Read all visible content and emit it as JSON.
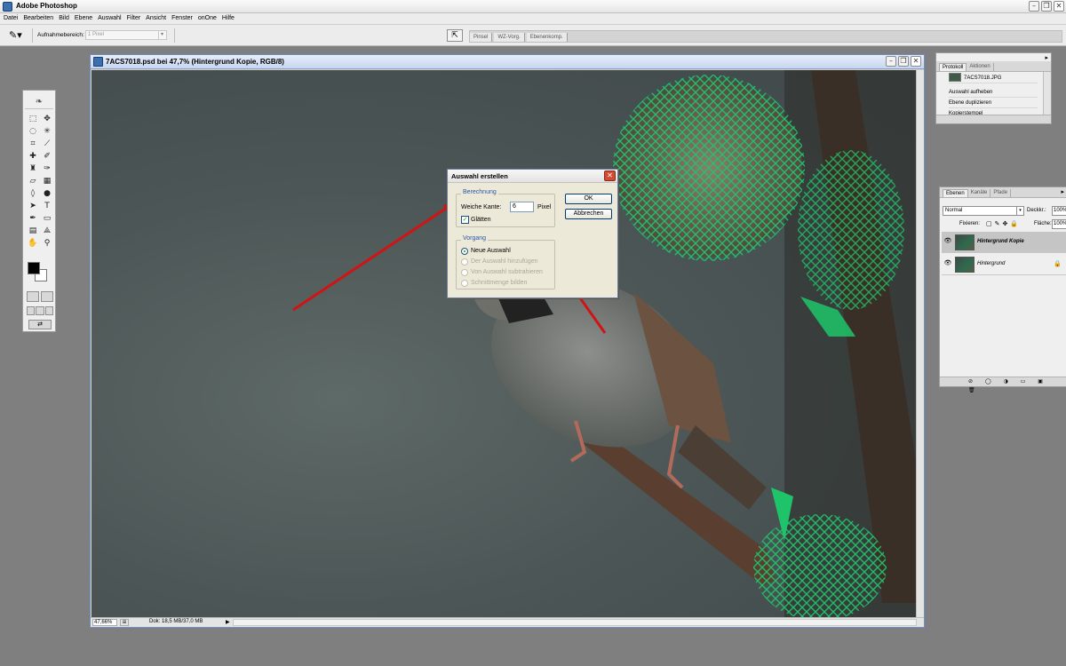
{
  "app": {
    "title": "Adobe Photoshop"
  },
  "menu": [
    "Datei",
    "Bearbeiten",
    "Bild",
    "Ebene",
    "Auswahl",
    "Filter",
    "Ansicht",
    "Fenster",
    "onOne",
    "Hilfe"
  ],
  "options": {
    "sample_label": "Aufnahmebereich:",
    "sample_value": "1 Pixel",
    "well_tabs": [
      "Pinsel",
      "WZ-Vorg.",
      "Ebenenkomp."
    ]
  },
  "document": {
    "title": "7ACS7018.psd bei 47,7% (Hintergrund Kopie, RGB/8)",
    "zoom": "47,66%",
    "doc_info": "Dok: 18,5 MB/37,0 MB"
  },
  "dialog": {
    "title": "Auswahl erstellen",
    "group_calc": "Berechnung",
    "feather_label": "Weiche Kante:",
    "feather_value": "6",
    "feather_unit": "Pixel",
    "smooth_label": "Glätten",
    "smooth_checked": true,
    "group_op": "Vorgang",
    "ops": [
      {
        "label": "Neue Auswahl",
        "selected": true,
        "enabled": true
      },
      {
        "label": "Der Auswahl hinzufügen",
        "selected": false,
        "enabled": false
      },
      {
        "label": "Von Auswahl subtrahieren",
        "selected": false,
        "enabled": false
      },
      {
        "label": "Schnittmenge bilden",
        "selected": false,
        "enabled": false
      }
    ],
    "ok_label": "OK",
    "cancel_label": "Abbrechen"
  },
  "history": {
    "tabs": [
      "Protokoll",
      "Aktionen"
    ],
    "snapshot": "7ACS7018.JPG",
    "items": [
      "Auswahl aufheben",
      "Ebene duplizieren",
      "Kopierstempel"
    ]
  },
  "layers": {
    "tabs": [
      "Ebenen",
      "Kanäle",
      "Pfade"
    ],
    "blend_mode": "Normal",
    "opacity_label": "Deckkr.:",
    "opacity": "100%",
    "lock_label": "Fixieren:",
    "fill_label": "Fläche:",
    "fill": "100%",
    "list": [
      {
        "name": "Hintergrund Kopie",
        "active": true
      },
      {
        "name": "Hintergrund",
        "active": false
      }
    ]
  },
  "colors": {
    "annotation_arrow": "#d01414",
    "net_green": "#1fc46a",
    "dialog_title_blue": "#2a56a8"
  }
}
